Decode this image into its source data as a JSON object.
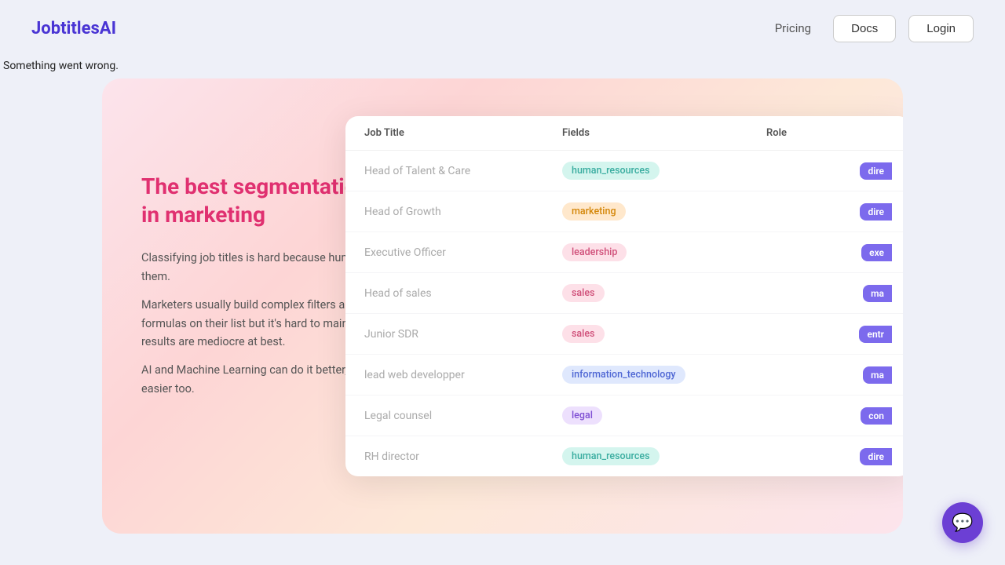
{
  "navbar": {
    "logo": "JobtitlesAI",
    "pricing_label": "Pricing",
    "docs_label": "Docs",
    "login_label": "Login"
  },
  "error": {
    "message": "Something went wrong."
  },
  "hero": {
    "headline": "The best segmentation\nin marketing",
    "body": [
      "Classifying job titles is hard because humans write them.",
      "Marketers usually build complex filters and formulas on their list but it's hard to maintain, and results are mediocre at best.",
      "AI and Machine Learning can do it better, and it's easier too."
    ]
  },
  "table": {
    "headers": [
      "Job Title",
      "Fields",
      "Role"
    ],
    "rows": [
      {
        "title": "Head of Talent & Care",
        "field": "human_resources",
        "field_class": "tag-hr",
        "role": "dire",
        "role_class": "role-director"
      },
      {
        "title": "Head of Growth",
        "field": "marketing",
        "field_class": "tag-marketing",
        "role": "dire",
        "role_class": "role-director"
      },
      {
        "title": "Executive Officer",
        "field": "leadership",
        "field_class": "tag-leadership",
        "role": "exe",
        "role_class": "role-exec"
      },
      {
        "title": "Head of sales",
        "field": "sales",
        "field_class": "tag-sales",
        "role": "ma",
        "role_class": "role-manager"
      },
      {
        "title": "Junior SDR",
        "field": "sales",
        "field_class": "tag-sales",
        "role": "entr",
        "role_class": "role-entry"
      },
      {
        "title": "lead web developper",
        "field": "information_technology",
        "field_class": "tag-it",
        "role": "ma",
        "role_class": "role-manager"
      },
      {
        "title": "Legal counsel",
        "field": "legal",
        "field_class": "tag-legal",
        "role": "con",
        "role_class": "role-consultant"
      },
      {
        "title": "RH director",
        "field": "human_resources",
        "field_class": "tag-hr",
        "role": "dire",
        "role_class": "role-director"
      }
    ]
  },
  "chat": {
    "icon": "💬"
  }
}
